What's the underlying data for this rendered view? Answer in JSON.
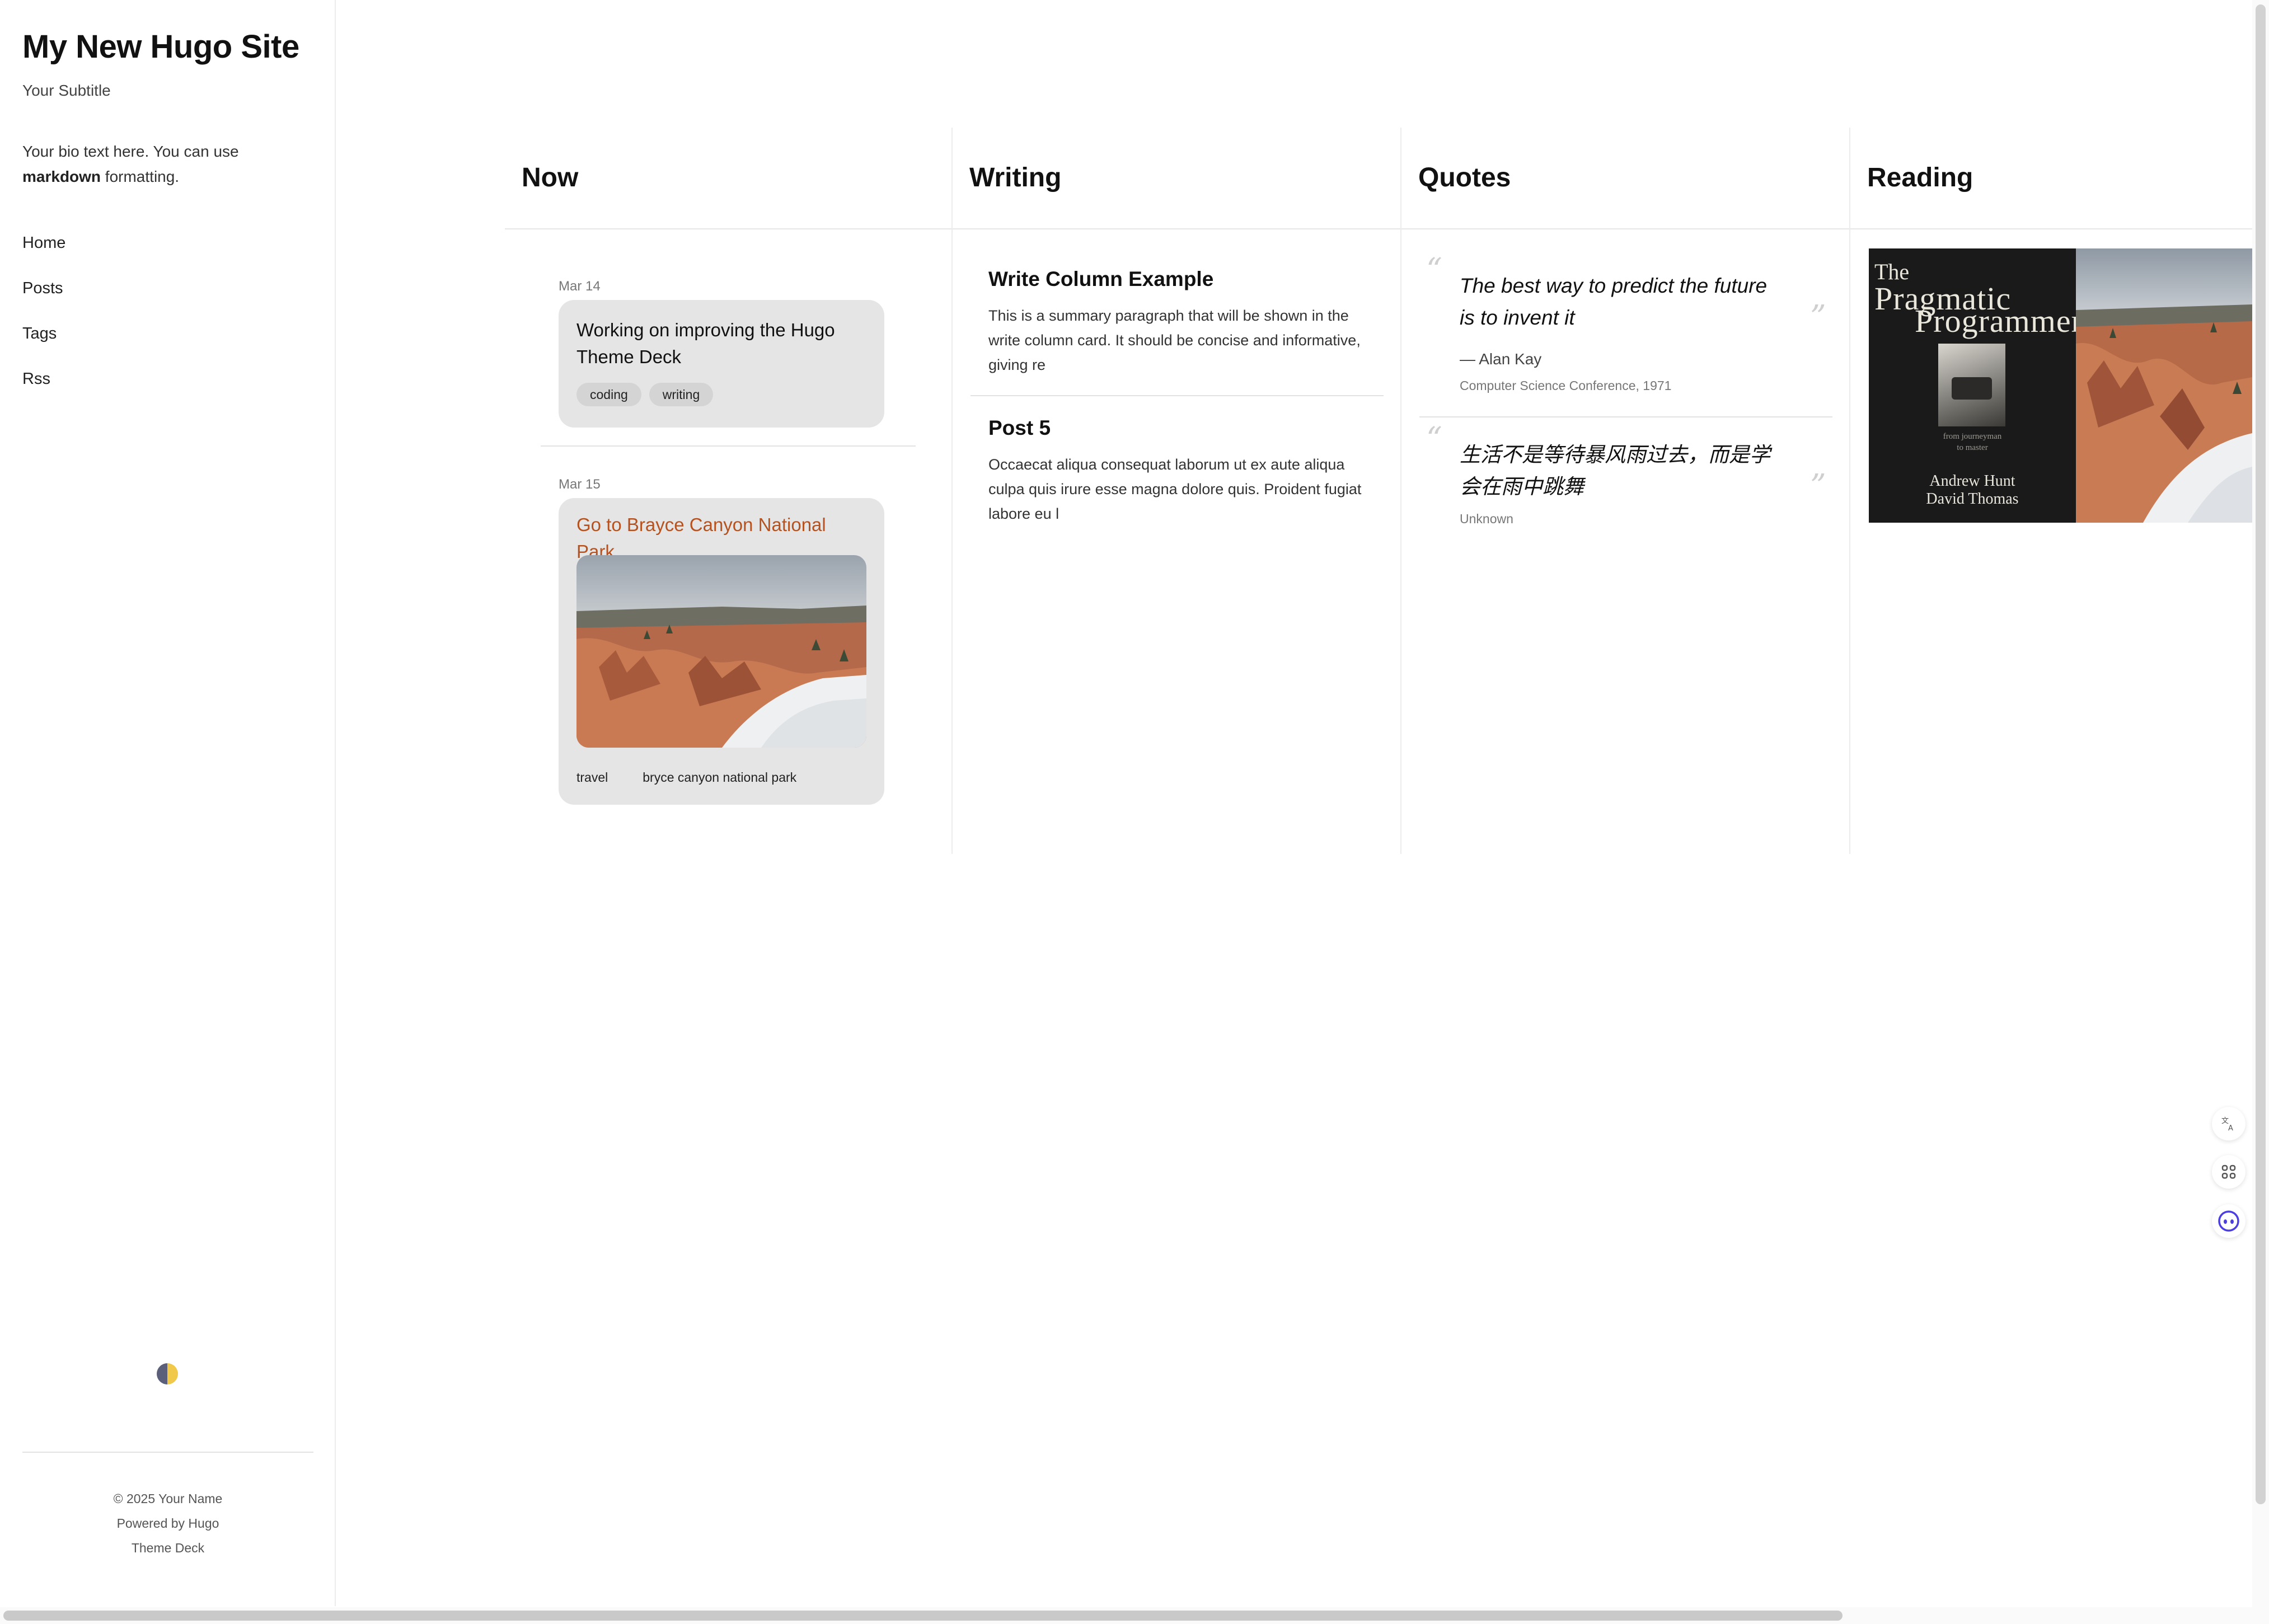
{
  "sidebar": {
    "title": "My New Hugo Site",
    "subtitle": "Your Subtitle",
    "bio_prefix": "Your bio text here. You can use ",
    "bio_bold": "markdown",
    "bio_suffix": " formatting.",
    "nav": [
      "Home",
      "Posts",
      "Tags",
      "Rss"
    ],
    "footer": {
      "copyright": "© 2025 Your Name",
      "powered": "Powered by Hugo",
      "theme": "Theme Deck"
    }
  },
  "columns": {
    "now": {
      "heading": "Now",
      "entries": [
        {
          "date": "Mar 14",
          "title": "Working on improving the Hugo Theme Deck",
          "tags": [
            "coding",
            "writing"
          ]
        },
        {
          "date": "Mar 15",
          "title": "Go to Brayce Canyon National Park",
          "tags": [
            "travel",
            "bryce canyon national park"
          ]
        }
      ]
    },
    "writing": {
      "heading": "Writing",
      "posts": [
        {
          "title": "Write Column Example",
          "summary": "This is a summary paragraph that will be shown in the write column card. It should be concise and informative, giving re"
        },
        {
          "title": "Post 5",
          "summary": "Occaecat aliqua consequat laborum ut ex aute aliqua culpa quis irure esse magna dolore quis. Proident fugiat labore eu l"
        }
      ]
    },
    "quotes": {
      "heading": "Quotes",
      "open_mark": "“",
      "close_mark": "”",
      "items": [
        {
          "text": "The best way to predict the future is to invent it",
          "author": "— Alan Kay",
          "source": "Computer Science Conference, 1971"
        },
        {
          "text": "生活不是等待暴风雨过去，而是学会在雨中跳舞",
          "source": "Unknown"
        }
      ]
    },
    "reading": {
      "heading": "Reading",
      "book": {
        "title_the": "The",
        "title_line1": "Pragmatic",
        "title_line2": "Programmer",
        "tagline_1": "from journeyman",
        "tagline_2": "to master",
        "author_1": "Andrew Hunt",
        "author_2": "David Thomas"
      }
    }
  },
  "colors": {
    "accent_link": "#b5521f",
    "card_bg": "#e5e5e5",
    "assistant_icon": "#4b3fe0"
  },
  "icons": {
    "theme_toggle": "half-moon-sun-icon",
    "float_1": "translate-icon",
    "float_2": "grid-command-icon",
    "float_3": "assistant-eyes-icon"
  }
}
